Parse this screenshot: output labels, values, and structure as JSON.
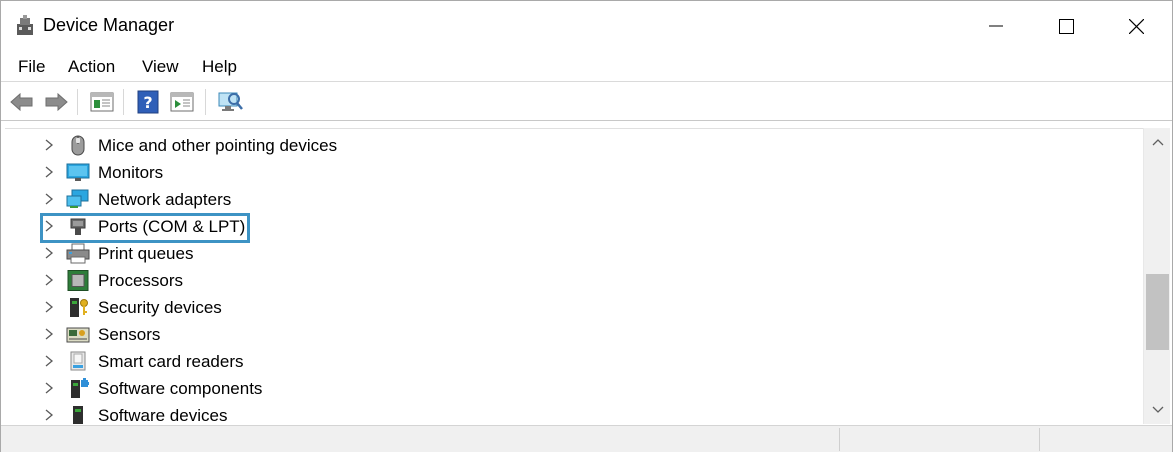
{
  "window": {
    "title": "Device Manager"
  },
  "menu": {
    "file": "File",
    "action": "Action",
    "view": "View",
    "help": "Help"
  },
  "toolbar": {
    "icons": [
      "back-arrow-icon",
      "forward-arrow-icon",
      "console-tree-icon",
      "help-icon",
      "properties-icon",
      "scan-hardware-icon"
    ]
  },
  "tree": {
    "items": [
      {
        "label": "Mice and other pointing devices",
        "icon": "mouse-icon"
      },
      {
        "label": "Monitors",
        "icon": "monitor-icon"
      },
      {
        "label": "Network adapters",
        "icon": "network-adapter-icon"
      },
      {
        "label": "Ports (COM & LPT)",
        "icon": "port-icon",
        "selected": true
      },
      {
        "label": "Print queues",
        "icon": "printer-icon"
      },
      {
        "label": "Processors",
        "icon": "processor-icon"
      },
      {
        "label": "Security devices",
        "icon": "security-device-icon"
      },
      {
        "label": "Sensors",
        "icon": "sensor-icon"
      },
      {
        "label": "Smart card readers",
        "icon": "smart-card-reader-icon"
      },
      {
        "label": "Software components",
        "icon": "software-component-icon"
      },
      {
        "label": "Software devices",
        "icon": "software-device-icon"
      }
    ]
  },
  "colors": {
    "selection_border": "#3d93c4",
    "scrollbar_thumb": "#c2c2c2"
  }
}
